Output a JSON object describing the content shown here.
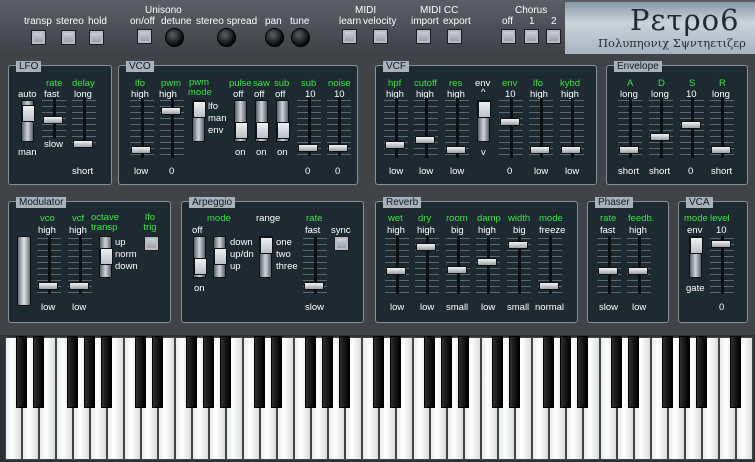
{
  "header": {
    "logo_title": "Ρετρο6",
    "logo_subtitle": "Πολυπηονιχ Σψντηετιζερ",
    "transp": "transp",
    "stereo": "stereo",
    "hold": "hold",
    "unisono": "Unisono",
    "onoff": "on/off",
    "detune": "detune",
    "stereo_spread": "stereo spread",
    "pan": "pan",
    "tune": "tune",
    "midi": "MIDI",
    "learn": "learn",
    "velocity": "velocity",
    "midi_cc": "MIDI CC",
    "import": "import",
    "export": "export",
    "chorus": "Chorus",
    "chorus_off": "off",
    "chorus_1": "1",
    "chorus_2": "2"
  },
  "lfo": {
    "title": "LFO",
    "rate": "rate",
    "delay": "delay",
    "auto": "auto",
    "man": "man",
    "fast": "fast",
    "slow": "slow",
    "long": "long",
    "short": "short",
    "rate_level": 0.45,
    "delay_level": 0.08
  },
  "vco": {
    "title": "VCO",
    "lfo": "lfo",
    "pwm": "pwm",
    "pwm_mode": "pwm mode",
    "pulse": "pulse",
    "saw": "saw",
    "sub1": "sub",
    "sub2": "sub",
    "noise": "noise",
    "high": "high",
    "low": "low",
    "zero": "0",
    "mode_lfo": "lfo",
    "mode_man": "man",
    "mode_env": "env",
    "off": "off",
    "on": "on",
    "ten": "10",
    "lfo_level": 0.05,
    "pwm_level": 0.82,
    "sub_level": 0.05,
    "noise_level": 0.05
  },
  "vcf": {
    "title": "VCF",
    "hpf": "hpf",
    "cutoff": "cutoff",
    "res": "res",
    "env_pol": "env",
    "env": "env",
    "lfo": "lfo",
    "kybd": "kybd",
    "high": "high",
    "low": "low",
    "caret": "^",
    "v": "v",
    "ten": "10",
    "zero": "0",
    "hpf_level": 0.15,
    "cutoff_level": 0.25,
    "res_level": 0.05,
    "env_level": 0.6,
    "lfo_level": 0.05,
    "kybd_level": 0.05
  },
  "envelope": {
    "title": "Envelope",
    "a": "A",
    "d": "D",
    "s": "S",
    "r": "R",
    "long": "long",
    "short": "short",
    "ten": "10",
    "zero": "0",
    "a_level": 0.05,
    "d_level": 0.3,
    "s_level": 0.55,
    "r_level": 0.05
  },
  "modulator": {
    "title": "Modulator",
    "vco": "vco",
    "vcf": "vcf",
    "octave_transp": "octave transp",
    "lfo_trig": "lfo trig",
    "high": "high",
    "low": "low",
    "up": "up",
    "norm": "norm",
    "down": "down",
    "vco_level": 0.05,
    "vcf_level": 0.05
  },
  "arpeggio": {
    "title": "Arpeggio",
    "mode": "mode",
    "range": "range",
    "rate": "rate",
    "sync": "sync",
    "off": "off",
    "on": "on",
    "down": "down",
    "updn": "up/dn",
    "up": "up",
    "one": "one",
    "two": "two",
    "three": "three",
    "fast": "fast",
    "slow": "slow",
    "rate_level": 0.05
  },
  "reverb": {
    "title": "Reverb",
    "wet": "wet",
    "dry": "dry",
    "room": "room",
    "damp": "damp",
    "width": "width",
    "mode": "mode",
    "high": "high",
    "low": "low",
    "big": "big",
    "small": "small",
    "freeze": "freeze",
    "normal": "normal",
    "wet_level": 0.35,
    "dry_level": 0.85,
    "room_level": 0.38,
    "damp_level": 0.55,
    "width_level": 0.9,
    "mode_level": 0.05
  },
  "phaser": {
    "title": "Phaser",
    "rate": "rate",
    "feedb": "feedb.",
    "fast": "fast",
    "high": "high",
    "slow": "slow",
    "low": "low",
    "rate_level": 0.35,
    "feedb_level": 0.35
  },
  "vca": {
    "title": "VCA",
    "mode": "mode",
    "level": "level",
    "env": "env",
    "gate": "gate",
    "ten": "10",
    "zero": "0",
    "level_level": 0.92
  },
  "keyboard": {
    "white_key_count": 44
  }
}
